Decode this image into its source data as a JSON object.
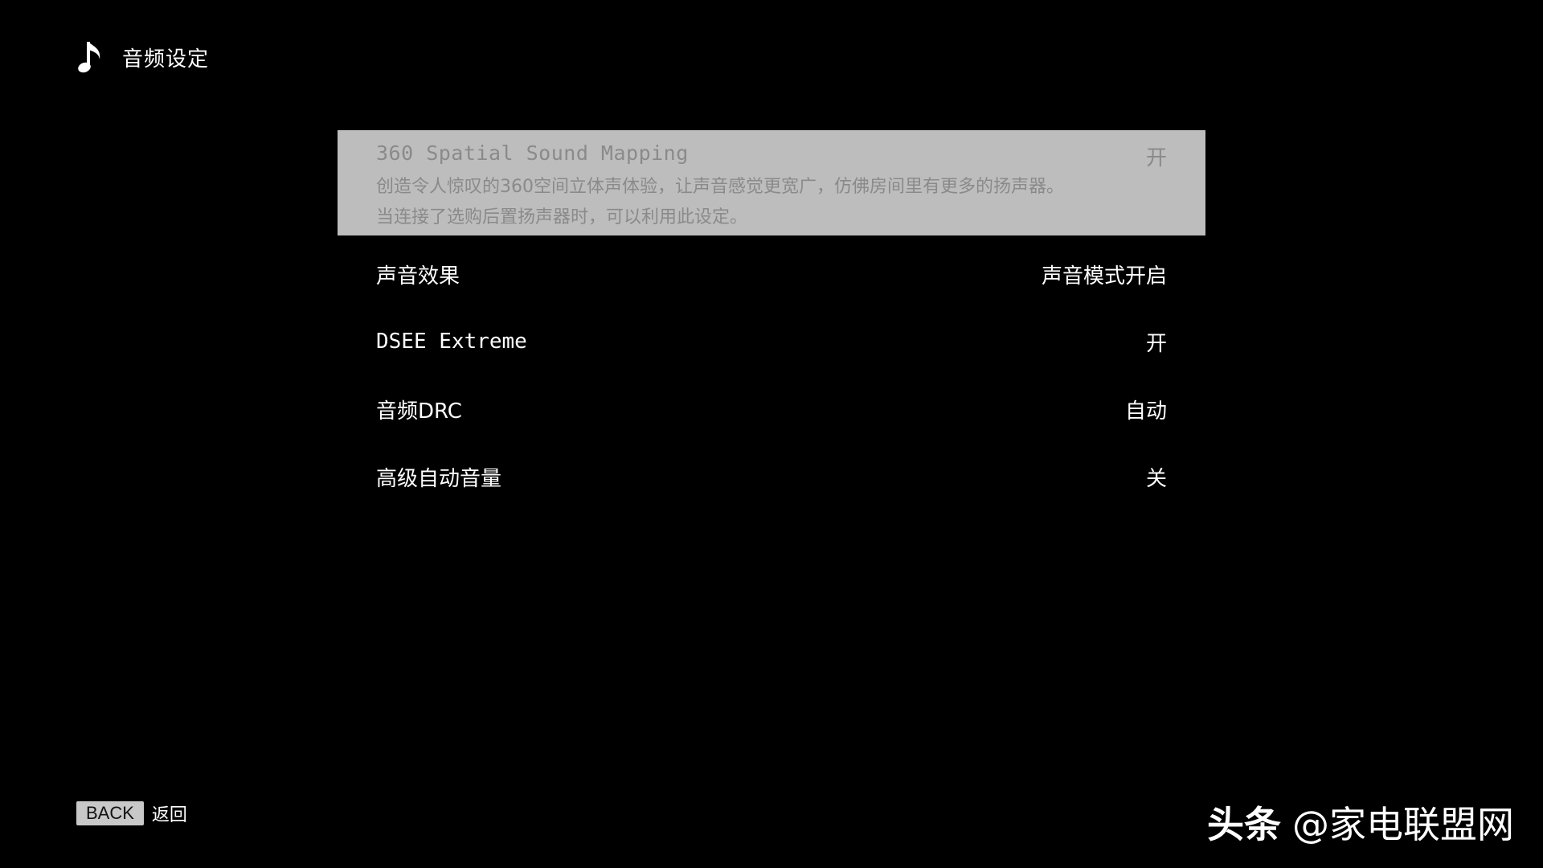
{
  "header": {
    "icon": "music-note-icon",
    "title": "音频设定"
  },
  "menu": {
    "items": [
      {
        "label": "360 Spatial Sound Mapping",
        "value": "开",
        "selected": true,
        "description": [
          "创造令人惊叹的360空间立体声体验，让声音感觉更宽广，仿佛房间里有更多的扬声器。",
          "当连接了选购后置扬声器时，可以利用此设定。"
        ]
      },
      {
        "label": "声音效果",
        "value": "声音模式开启"
      },
      {
        "label": "DSEE Extreme",
        "value": "开"
      },
      {
        "label": "音频DRC",
        "value": "自动"
      },
      {
        "label": "高级自动音量",
        "value": "关"
      }
    ]
  },
  "footer": {
    "back_key": "BACK",
    "back_label": "返回"
  },
  "watermark": {
    "brand": "头条",
    "handle": "@家电联盟网"
  },
  "colors": {
    "background": "#000000",
    "selected_row": "#bdbdbd",
    "selected_text": "#8a8a8a",
    "text": "#ffffff",
    "back_key_bg": "#c8c8c8"
  }
}
